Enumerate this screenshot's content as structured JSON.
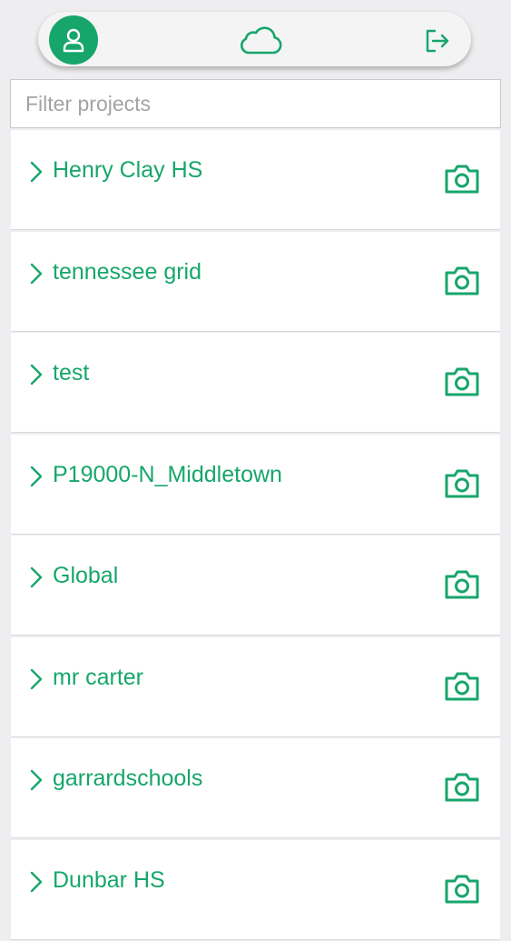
{
  "colors": {
    "accent": "#16a66b",
    "background": "#eeeef0"
  },
  "header": {
    "profile_icon": "user-icon",
    "logo_icon": "cloud-icon",
    "logout_icon": "logout-icon"
  },
  "filter": {
    "placeholder": "Filter projects",
    "value": ""
  },
  "projects": [
    {
      "name": "Henry Clay HS"
    },
    {
      "name": "tennessee grid"
    },
    {
      "name": "test"
    },
    {
      "name": "P19000-N_Middletown"
    },
    {
      "name": "Global"
    },
    {
      "name": "mr carter"
    },
    {
      "name": "garrardschools"
    },
    {
      "name": "Dunbar HS"
    }
  ]
}
